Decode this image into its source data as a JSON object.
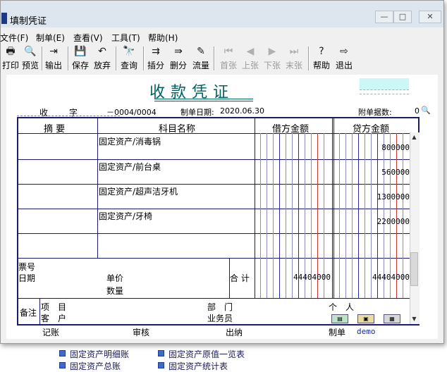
{
  "window": {
    "title": "填制凭证",
    "controls": [
      "—",
      "□",
      "✕"
    ]
  },
  "menu": [
    "文件(F)",
    "制单(E)",
    "查看(V)",
    "工具(T)",
    "帮助(H)"
  ],
  "toolbar": [
    {
      "label": "打印",
      "icon": "printer-icon",
      "glyph": "🖶",
      "enabled": true
    },
    {
      "label": "预览",
      "icon": "preview-icon",
      "glyph": "🔍",
      "enabled": true
    },
    {
      "label": "输出",
      "icon": "export-icon",
      "glyph": "⇥",
      "enabled": true
    },
    {
      "label": "保存",
      "icon": "save-icon",
      "glyph": "💾",
      "enabled": true
    },
    {
      "label": "放弃",
      "icon": "undo-icon",
      "glyph": "↶",
      "enabled": true
    },
    {
      "label": "查询",
      "icon": "binoculars-icon",
      "glyph": "🔭",
      "enabled": true
    },
    {
      "label": "插分",
      "icon": "insert-row-icon",
      "glyph": "⇉",
      "enabled": true
    },
    {
      "label": "删分",
      "icon": "delete-row-icon",
      "glyph": "⇛",
      "enabled": true
    },
    {
      "label": "流量",
      "icon": "flow-icon",
      "glyph": "✎",
      "enabled": true
    },
    {
      "label": "首张",
      "icon": "first-record-icon",
      "glyph": "⏮",
      "enabled": false
    },
    {
      "label": "上张",
      "icon": "prev-record-icon",
      "glyph": "◀",
      "enabled": false
    },
    {
      "label": "下张",
      "icon": "next-record-icon",
      "glyph": "▶",
      "enabled": false
    },
    {
      "label": "末张",
      "icon": "last-record-icon",
      "glyph": "⏭",
      "enabled": false
    },
    {
      "label": "帮助",
      "icon": "help-icon",
      "glyph": "?",
      "enabled": true
    },
    {
      "label": "退出",
      "icon": "exit-icon",
      "glyph": "⇨",
      "enabled": true
    }
  ],
  "voucher": {
    "title": "收款凭证",
    "type_label": "收",
    "zi_label": "字",
    "number": "－0004/0004",
    "date_label": "制单日期:",
    "date": "2020.06.30",
    "attach_label": "附单据数:",
    "attach_count": "0",
    "col_summary": "摘 要",
    "col_account": "科目名称",
    "col_debit": "借方金额",
    "col_credit": "贷方金额",
    "rows": [
      {
        "summary": "",
        "account": "固定资产/消毒锅",
        "debit": "",
        "credit": "800000"
      },
      {
        "summary": "",
        "account": "固定资产/前台桌",
        "debit": "",
        "credit": "560000"
      },
      {
        "summary": "",
        "account": "固定资产/超声洁牙机",
        "debit": "",
        "credit": "1300000"
      },
      {
        "summary": "",
        "account": "固定资产/牙椅",
        "debit": "",
        "credit": "2200000"
      },
      {
        "summary": "",
        "account": "",
        "debit": "",
        "credit": ""
      }
    ],
    "ticket_label": "票号",
    "date2_label": "日期",
    "price_label": "单价",
    "qty_label": "数量",
    "total_label": "合 计",
    "total_debit": "44404000",
    "total_credit": "44404000",
    "note_label": "备注",
    "project_label": "项　目",
    "dept_label": "部　门",
    "person_label": "个　人",
    "customer_label": "客　户",
    "salesman_label": "业务员",
    "bookkeep_label": "记账",
    "audit_label": "审核",
    "cashier_label": "出纳",
    "maker_label": "制单",
    "maker_name": "demo"
  },
  "background": {
    "items": [
      "固定资产明细账",
      "固定资产原值一览表",
      "固定资产总账",
      "固定资产统计表"
    ]
  }
}
